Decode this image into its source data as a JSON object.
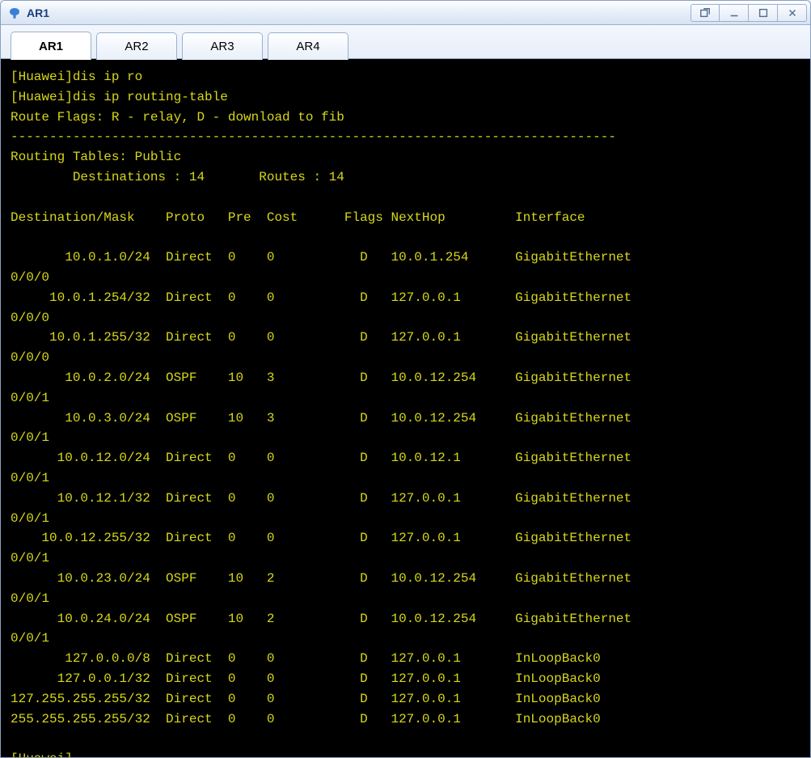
{
  "window": {
    "title": "AR1"
  },
  "tabs": [
    {
      "label": "AR1",
      "active": true
    },
    {
      "label": "AR2",
      "active": false
    },
    {
      "label": "AR3",
      "active": false
    },
    {
      "label": "AR4",
      "active": false
    }
  ],
  "terminal": {
    "prompt_host": "[Huawei]",
    "cmd1": "dis ip ro",
    "cmd2": "dis ip routing-table",
    "route_flags_line": "Route Flags: R - relay, D - download to fib",
    "separator": "------------------------------------------------------------------------------",
    "routing_tables_line": "Routing Tables: Public",
    "dest_count_label": "Destinations :",
    "dest_count": "14",
    "routes_label": "Routes :",
    "routes_count": "14",
    "headers": {
      "dest": "Destination/Mask",
      "proto": "Proto",
      "pre": "Pre",
      "cost": "Cost",
      "flags": "Flags",
      "nexthop": "NextHop",
      "iface": "Interface"
    },
    "rows": [
      {
        "dest": "10.0.1.0/24",
        "proto": "Direct",
        "pre": "0",
        "cost": "0",
        "flags": "D",
        "nexthop": "10.0.1.254",
        "iface": "GigabitEthernet",
        "ifsuffix": "0/0/0"
      },
      {
        "dest": "10.0.1.254/32",
        "proto": "Direct",
        "pre": "0",
        "cost": "0",
        "flags": "D",
        "nexthop": "127.0.0.1",
        "iface": "GigabitEthernet",
        "ifsuffix": "0/0/0"
      },
      {
        "dest": "10.0.1.255/32",
        "proto": "Direct",
        "pre": "0",
        "cost": "0",
        "flags": "D",
        "nexthop": "127.0.0.1",
        "iface": "GigabitEthernet",
        "ifsuffix": "0/0/0"
      },
      {
        "dest": "10.0.2.0/24",
        "proto": "OSPF",
        "pre": "10",
        "cost": "3",
        "flags": "D",
        "nexthop": "10.0.12.254",
        "iface": "GigabitEthernet",
        "ifsuffix": "0/0/1"
      },
      {
        "dest": "10.0.3.0/24",
        "proto": "OSPF",
        "pre": "10",
        "cost": "3",
        "flags": "D",
        "nexthop": "10.0.12.254",
        "iface": "GigabitEthernet",
        "ifsuffix": "0/0/1"
      },
      {
        "dest": "10.0.12.0/24",
        "proto": "Direct",
        "pre": "0",
        "cost": "0",
        "flags": "D",
        "nexthop": "10.0.12.1",
        "iface": "GigabitEthernet",
        "ifsuffix": "0/0/1"
      },
      {
        "dest": "10.0.12.1/32",
        "proto": "Direct",
        "pre": "0",
        "cost": "0",
        "flags": "D",
        "nexthop": "127.0.0.1",
        "iface": "GigabitEthernet",
        "ifsuffix": "0/0/1"
      },
      {
        "dest": "10.0.12.255/32",
        "proto": "Direct",
        "pre": "0",
        "cost": "0",
        "flags": "D",
        "nexthop": "127.0.0.1",
        "iface": "GigabitEthernet",
        "ifsuffix": "0/0/1"
      },
      {
        "dest": "10.0.23.0/24",
        "proto": "OSPF",
        "pre": "10",
        "cost": "2",
        "flags": "D",
        "nexthop": "10.0.12.254",
        "iface": "GigabitEthernet",
        "ifsuffix": "0/0/1"
      },
      {
        "dest": "10.0.24.0/24",
        "proto": "OSPF",
        "pre": "10",
        "cost": "2",
        "flags": "D",
        "nexthop": "10.0.12.254",
        "iface": "GigabitEthernet",
        "ifsuffix": "0/0/1"
      },
      {
        "dest": "127.0.0.0/8",
        "proto": "Direct",
        "pre": "0",
        "cost": "0",
        "flags": "D",
        "nexthop": "127.0.0.1",
        "iface": "InLoopBack0",
        "ifsuffix": ""
      },
      {
        "dest": "127.0.0.1/32",
        "proto": "Direct",
        "pre": "0",
        "cost": "0",
        "flags": "D",
        "nexthop": "127.0.0.1",
        "iface": "InLoopBack0",
        "ifsuffix": ""
      },
      {
        "dest": "127.255.255.255/32",
        "proto": "Direct",
        "pre": "0",
        "cost": "0",
        "flags": "D",
        "nexthop": "127.0.0.1",
        "iface": "InLoopBack0",
        "ifsuffix": ""
      },
      {
        "dest": "255.255.255.255/32",
        "proto": "Direct",
        "pre": "0",
        "cost": "0",
        "flags": "D",
        "nexthop": "127.0.0.1",
        "iface": "InLoopBack0",
        "ifsuffix": ""
      }
    ],
    "final_prompt": "[Huawei]"
  }
}
